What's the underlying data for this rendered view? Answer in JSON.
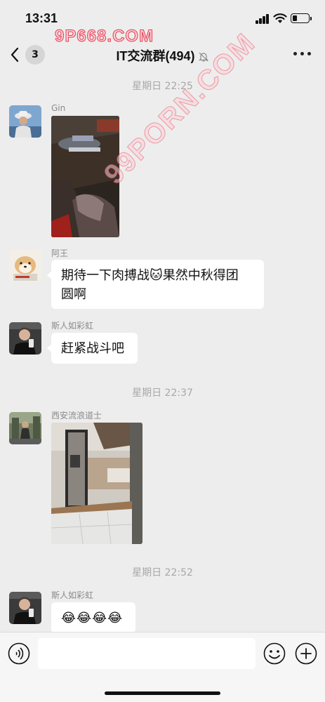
{
  "status": {
    "time": "13:31"
  },
  "watermark": {
    "top": "9P668.COM",
    "diagonal": "99PORN.COM"
  },
  "nav": {
    "badge": "3",
    "title": "IT交流群(494)"
  },
  "timestamps": [
    "星期日 22:25",
    "星期日 22:37",
    "星期日 22:52"
  ],
  "messages": [
    {
      "sender": "Gin",
      "type": "image"
    },
    {
      "sender": "阿王",
      "type": "text",
      "line1": "期待一下肉搏战🐱果然中秋得团",
      "line2": "圆啊"
    },
    {
      "sender": "斯人如彩虹",
      "type": "text",
      "text": "赶紧战斗吧"
    },
    {
      "sender": "西安流浪道士",
      "type": "image"
    },
    {
      "sender": "斯人如彩虹",
      "type": "emoji",
      "text": "😂😂😂😂"
    }
  ],
  "colors": {
    "background": "#ededed",
    "bubble": "#ffffff",
    "input_bar": "#f6f6f6",
    "timestamp": "#a8a8a8"
  },
  "icons": [
    "back-chevron",
    "mute-bell",
    "more-dots",
    "voice",
    "emoji",
    "plus"
  ]
}
